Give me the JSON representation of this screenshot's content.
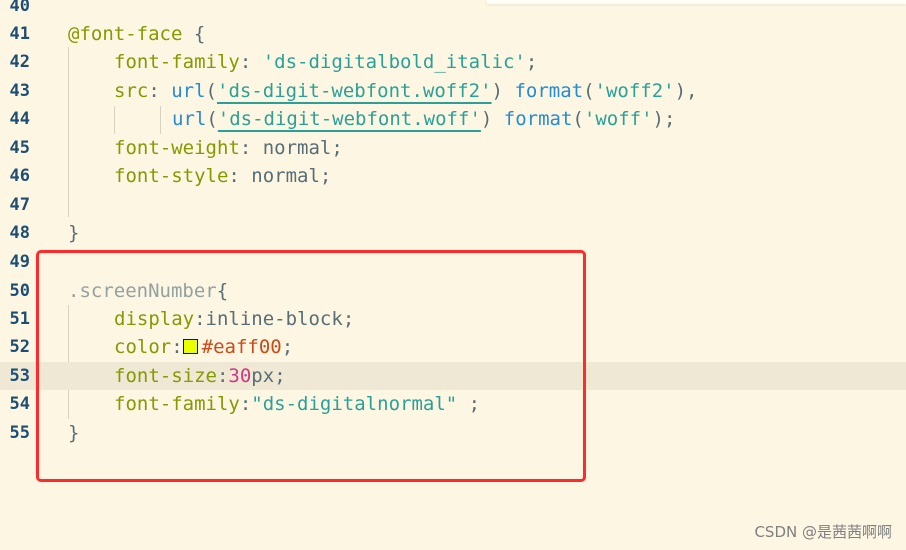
{
  "editor": {
    "line_numbers": [
      "40",
      "41",
      "42",
      "43",
      "44",
      "45",
      "46",
      "47",
      "48",
      "49",
      "50",
      "51",
      "52",
      "53",
      "54",
      "55"
    ],
    "lines": {
      "l41": {
        "at": "@font-face",
        "brace": " {"
      },
      "l42": {
        "prop": "font-family",
        "colon": ": ",
        "value": "'ds-digitalbold_italic'",
        "end": ";"
      },
      "l43": {
        "prop": "src",
        "colon": ": ",
        "func1": "url",
        "open1": "(",
        "str1": "'ds-digit-webfont.woff2'",
        "close1": ") ",
        "func2": "format",
        "open2": "(",
        "str2": "'woff2'",
        "close2": "),"
      },
      "l44": {
        "func1": "url",
        "open1": "(",
        "str1": "'ds-digit-webfont.woff'",
        "close1": ") ",
        "func2": "format",
        "open2": "(",
        "str2": "'woff'",
        "close2": ");"
      },
      "l45": {
        "prop": "font-weight",
        "colon": ": ",
        "value": "normal",
        "end": ";"
      },
      "l46": {
        "prop": "font-style",
        "colon": ": ",
        "value": "normal",
        "end": ";"
      },
      "l48": {
        "brace": "}"
      },
      "l50": {
        "selector": ".screenNumber",
        "brace": "{"
      },
      "l51": {
        "prop": "display",
        "colon": ":",
        "value": "inline-block",
        "end": ";"
      },
      "l52": {
        "prop": "color",
        "colon": ":",
        "value": "#eaff00",
        "end": ";"
      },
      "l53": {
        "prop": "font-size",
        "colon": ":",
        "num": "30",
        "unit": "px",
        "end": ";"
      },
      "l54": {
        "prop": "font-family",
        "colon": ":",
        "value": "\"ds-digitalnormal\"",
        "end": " ;"
      },
      "l55": {
        "brace": "}"
      }
    },
    "swatch_color": "#eaff00",
    "highlight_color": "#ff2a2a"
  },
  "watermark": "CSDN @是茜茜啊啊"
}
